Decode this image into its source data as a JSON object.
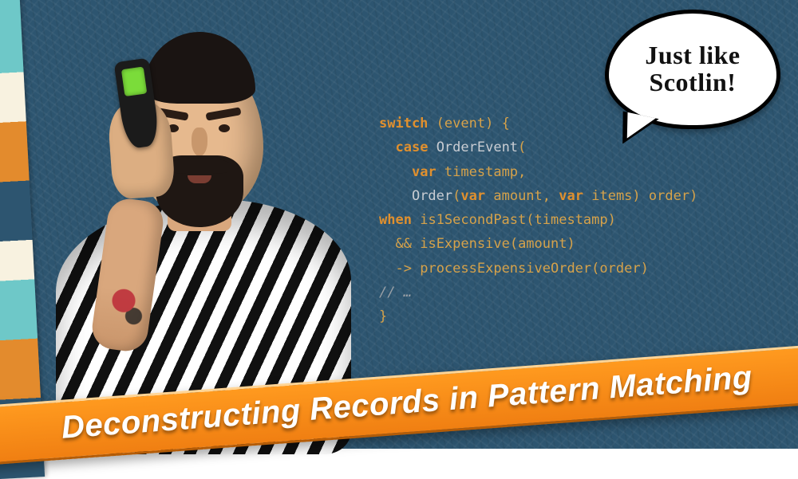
{
  "bubble": {
    "text": "Just like Scotlin!"
  },
  "banner": {
    "text": "Deconstructing Records in Pattern Matching"
  },
  "code": {
    "l1_kw_switch": "switch",
    "l1_paren_open": " (",
    "l1_event": "event",
    "l1_paren_close_brace": ") {",
    "l2_kw_case": "case",
    "l2_space": " ",
    "l2_type": "OrderEvent",
    "l2_open": "(",
    "l3_kw_var": "var",
    "l3_sp": " ",
    "l3_ts": "timestamp",
    "l3_comma": ",",
    "l4_type": "Order",
    "l4_open": "(",
    "l4_kw_var1": "var",
    "l4_sp1": " ",
    "l4_amount": "amount",
    "l4_comma": ", ",
    "l4_kw_var2": "var",
    "l4_sp2": " ",
    "l4_items": "items",
    "l4_close": ") ",
    "l4_order": "order",
    "l4_close2": ")",
    "l5_kw_when": "when",
    "l5_sp": " ",
    "l5_fn": "is1SecondPast",
    "l5_open": "(",
    "l5_arg": "timestamp",
    "l5_close": ")",
    "l6_and": "&&",
    "l6_sp": " ",
    "l6_fn": "isExpensive",
    "l6_open": "(",
    "l6_arg": "amount",
    "l6_close": ")",
    "l7_arrow": "->",
    "l7_sp": " ",
    "l7_fn": "processExpensiveOrder",
    "l7_open": "(",
    "l7_arg": "order",
    "l7_close": ")",
    "l8_comment": "// …",
    "l9_close": "}"
  }
}
